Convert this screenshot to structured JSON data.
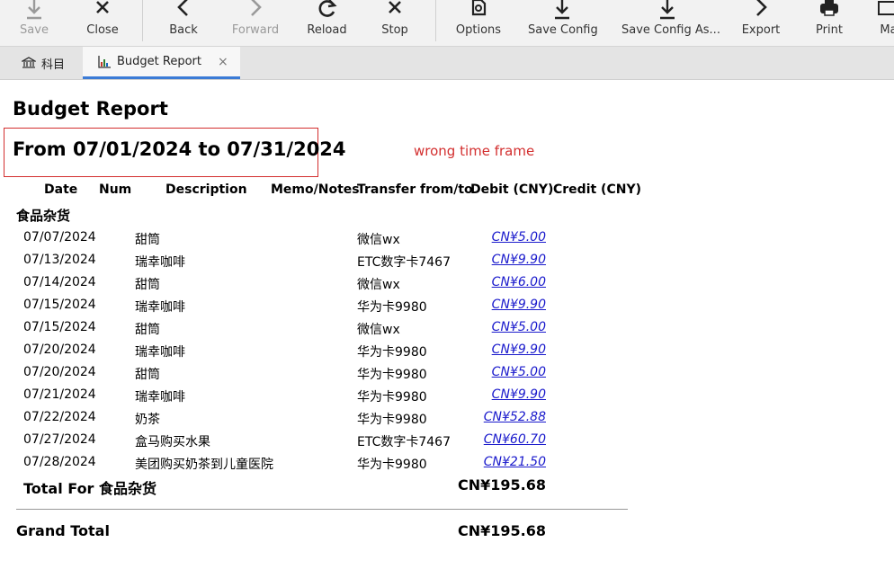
{
  "toolbar": {
    "buttons": [
      {
        "label": "Save",
        "icon": "save-icon",
        "enabled": false
      },
      {
        "label": "Close",
        "icon": "close-icon",
        "enabled": true
      },
      {
        "label": "Back",
        "icon": "back-icon",
        "enabled": true
      },
      {
        "label": "Forward",
        "icon": "forward-icon",
        "enabled": false
      },
      {
        "label": "Reload",
        "icon": "reload-icon",
        "enabled": true
      },
      {
        "label": "Stop",
        "icon": "stop-icon",
        "enabled": true
      },
      {
        "label": "Options",
        "icon": "options-icon",
        "enabled": true
      },
      {
        "label": "Save Config",
        "icon": "save-config-icon",
        "enabled": true
      },
      {
        "label": "Save Config As...",
        "icon": "save-config-as-icon",
        "enabled": true
      },
      {
        "label": "Export",
        "icon": "export-icon",
        "enabled": true
      },
      {
        "label": "Print",
        "icon": "print-icon",
        "enabled": true
      },
      {
        "label": "Ma",
        "icon": "mail-icon",
        "enabled": true
      }
    ]
  },
  "tabs": [
    {
      "label": "科目",
      "icon": "accounts-icon",
      "active": false
    },
    {
      "label": "Budget Report",
      "icon": "report-icon",
      "active": true,
      "close": "×"
    }
  ],
  "report": {
    "title": "Budget Report",
    "range": "From 07/01/2024 to 07/31/2024",
    "annotation": "wrong time frame",
    "annotation_color": "#d32f2f",
    "columns": [
      "Date",
      "Num",
      "Description",
      "Memo/Notes",
      "Transfer from/to",
      "Debit (CNY)",
      "Credit (CNY)"
    ],
    "account": "食品杂货",
    "rows": [
      {
        "date": "07/07/2024",
        "desc": "甜筒",
        "xfer": "微信wx",
        "debit": "CN¥5.00"
      },
      {
        "date": "07/13/2024",
        "desc": "瑞幸咖啡",
        "xfer": "ETC数字卡7467",
        "debit": "CN¥9.90"
      },
      {
        "date": "07/14/2024",
        "desc": "甜筒",
        "xfer": "微信wx",
        "debit": "CN¥6.00"
      },
      {
        "date": "07/15/2024",
        "desc": "瑞幸咖啡",
        "xfer": "华为卡9980",
        "debit": "CN¥9.90"
      },
      {
        "date": "07/15/2024",
        "desc": "甜筒",
        "xfer": "微信wx",
        "debit": "CN¥5.00"
      },
      {
        "date": "07/20/2024",
        "desc": "瑞幸咖啡",
        "xfer": "华为卡9980",
        "debit": "CN¥9.90"
      },
      {
        "date": "07/20/2024",
        "desc": "甜筒",
        "xfer": "华为卡9980",
        "debit": "CN¥5.00"
      },
      {
        "date": "07/21/2024",
        "desc": "瑞幸咖啡",
        "xfer": "华为卡9980",
        "debit": "CN¥9.90"
      },
      {
        "date": "07/22/2024",
        "desc": "奶茶",
        "xfer": "华为卡9980",
        "debit": "CN¥52.88"
      },
      {
        "date": "07/27/2024",
        "desc": "盒马购买水果",
        "xfer": "ETC数字卡7467",
        "debit": "CN¥60.70"
      },
      {
        "date": "07/28/2024",
        "desc": "美团购买奶茶到儿童医院",
        "xfer": "华为卡9980",
        "debit": "CN¥21.50"
      }
    ],
    "total_label": "Total For 食品杂货",
    "total_value": "CN¥195.68",
    "grand_label": "Grand Total",
    "grand_value": "CN¥195.68"
  }
}
